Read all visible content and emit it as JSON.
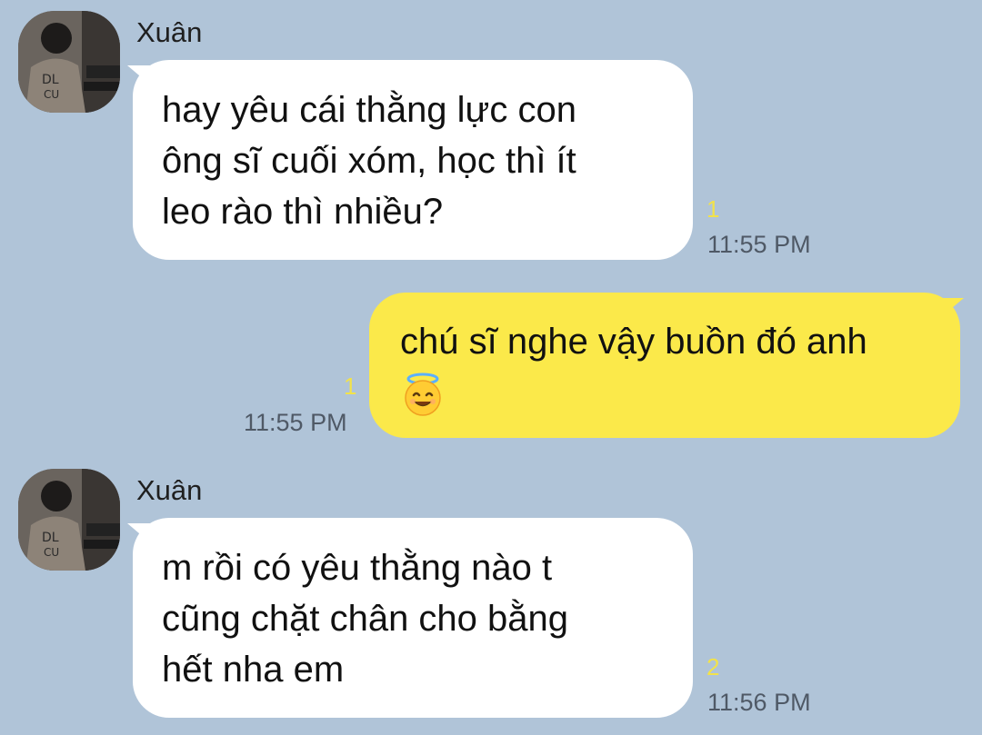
{
  "messages": [
    {
      "direction": "incoming",
      "sender": "Xuân",
      "avatar_icon": "avatar-photo",
      "lines": [
        "hay yêu cái thằng lực con",
        "ông sĩ cuối xóm, học thì ít",
        "leo rào thì nhiều?"
      ],
      "read_count": "1",
      "time": "11:55 PM"
    },
    {
      "direction": "outgoing",
      "lines": [
        "chú sĩ nghe vậy buồn đó anh"
      ],
      "emoji": "smiling-face-with-halo-icon",
      "read_count": "1",
      "time": "11:55 PM"
    },
    {
      "direction": "incoming",
      "sender": "Xuân",
      "avatar_icon": "avatar-photo",
      "lines": [
        "m rồi có yêu thằng nào t",
        "cũng chặt chân cho bằng",
        "hết nha em"
      ],
      "read_count": "2",
      "time": "11:56 PM"
    }
  ],
  "colors": {
    "background": "#b0c4d8",
    "incoming_bubble": "#ffffff",
    "outgoing_bubble": "#fbe94a",
    "read_count": "#f2e24a",
    "timestamp": "#4f5966"
  }
}
